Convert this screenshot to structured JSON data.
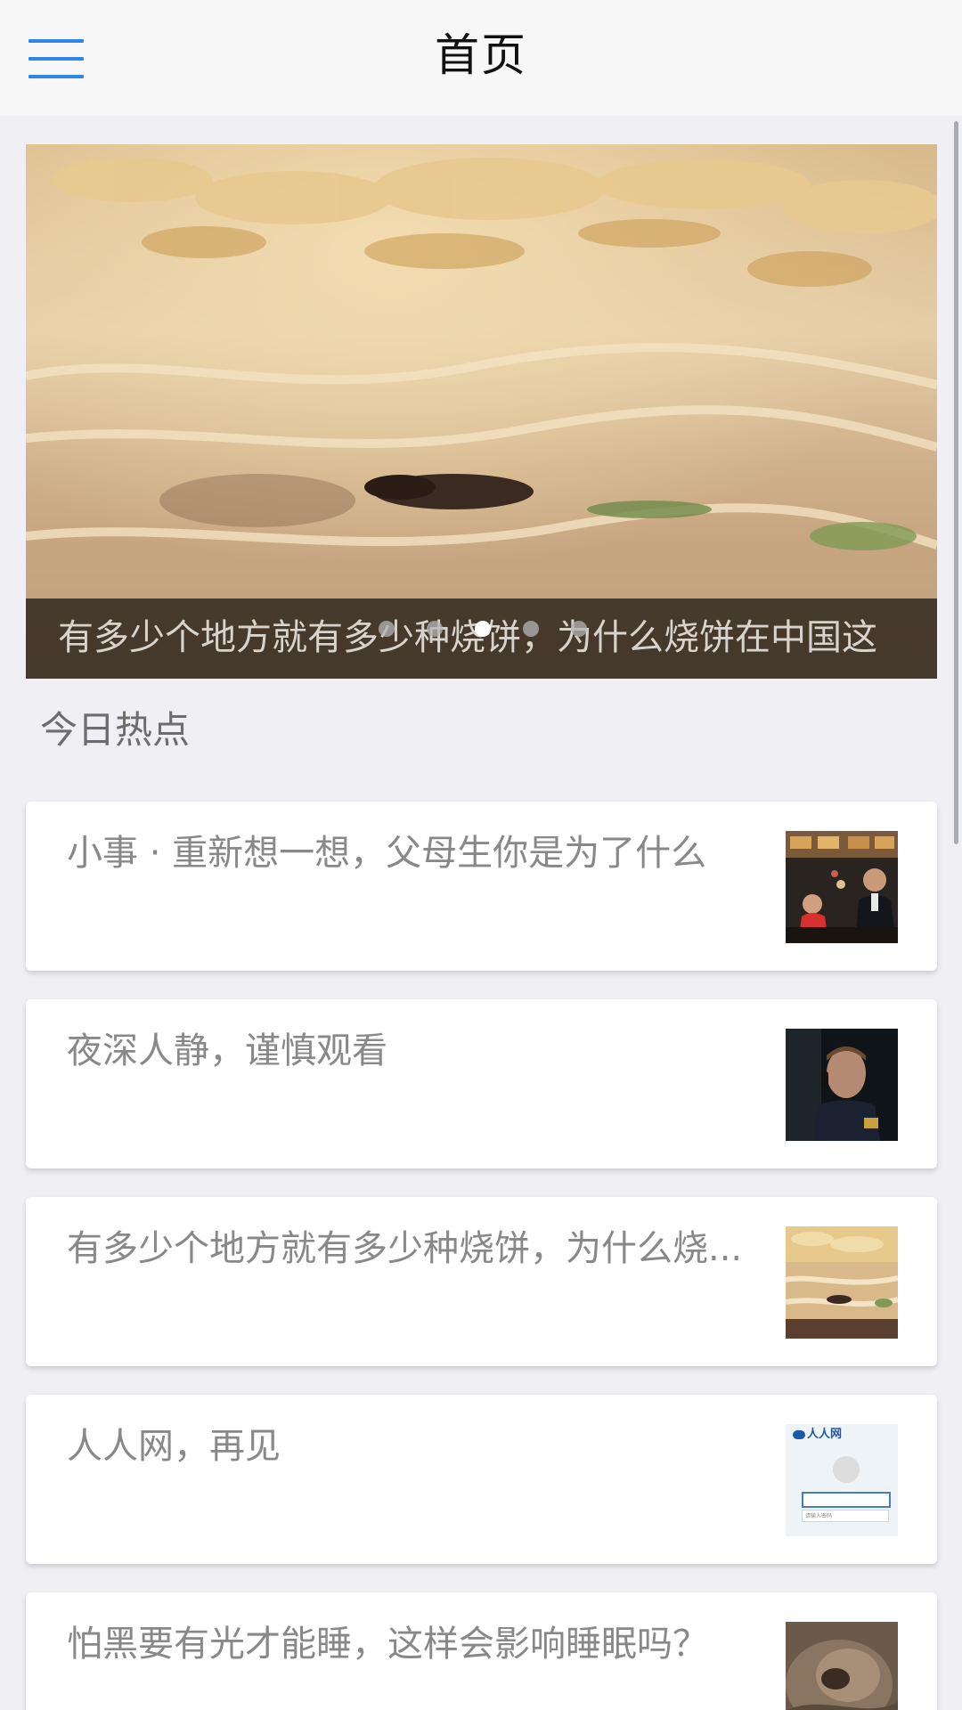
{
  "header": {
    "title": "首页",
    "menu_icon": "hamburger-menu-icon",
    "accent_color": "#2f86ea"
  },
  "banner": {
    "caption": "有多少个地方就有多少种烧饼，为什么烧饼在中国这",
    "slide_count": 5,
    "active_slide": 3
  },
  "section": {
    "title": "今日热点"
  },
  "stories": [
    {
      "title": "小事 · 重新想一想，父母生你是为了什么"
    },
    {
      "title": "夜深人静，谨慎观看"
    },
    {
      "title": "有多少个地方就有多少种烧饼，为什么烧..."
    },
    {
      "title": "人人网，再见"
    },
    {
      "title": "怕黑要有光才能睡，这样会影响睡眠吗？"
    }
  ],
  "thumb_renren": {
    "logo_text": "人人网",
    "placeholder": "请输入密码"
  }
}
